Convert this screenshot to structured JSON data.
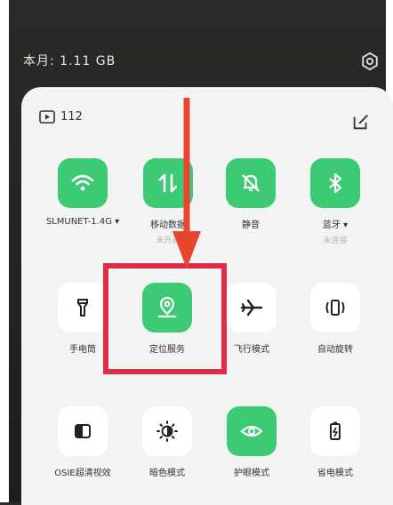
{
  "status": {
    "data_usage": "本月: 1.11 GB"
  },
  "panel": {
    "media_count": "112"
  },
  "tiles": [
    {
      "label": "SLMUNET-1.4G ▾",
      "sub": "",
      "state": "on",
      "icon": "wifi-icon"
    },
    {
      "label": "移动数据",
      "sub": "未开启",
      "state": "on",
      "icon": "mobile-data-icon"
    },
    {
      "label": "静音",
      "sub": "",
      "state": "on",
      "icon": "mute-bell-icon"
    },
    {
      "label": "蓝牙 ▾",
      "sub": "未连接",
      "state": "on",
      "icon": "bluetooth-icon"
    },
    {
      "label": "手电筒",
      "sub": "",
      "state": "off",
      "icon": "flashlight-icon"
    },
    {
      "label": "定位服务",
      "sub": "",
      "state": "on",
      "icon": "location-icon"
    },
    {
      "label": "飞行模式",
      "sub": "",
      "state": "off",
      "icon": "airplane-icon"
    },
    {
      "label": "自动旋转",
      "sub": "",
      "state": "off",
      "icon": "auto-rotate-icon"
    },
    {
      "label": "OSIE超清视效",
      "sub": "",
      "state": "off",
      "icon": "osie-icon"
    },
    {
      "label": "暗色模式",
      "sub": "",
      "state": "off",
      "icon": "dark-mode-icon"
    },
    {
      "label": "护眼模式",
      "sub": "",
      "state": "on",
      "icon": "eye-care-icon"
    },
    {
      "label": "省电模式",
      "sub": "",
      "state": "off",
      "icon": "battery-saver-icon"
    }
  ],
  "colors": {
    "tile_on": "#3dca74",
    "highlight": "#e22b46",
    "arrow": "#e8452f"
  }
}
